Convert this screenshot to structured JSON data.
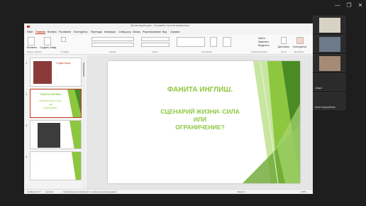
{
  "window": {
    "title": "Презентация1.pptx - Сохранено на этом компьютере",
    "controls": [
      "—",
      "❐",
      "✕"
    ]
  },
  "menu": {
    "items": [
      "Файл",
      "Главная",
      "Вставка",
      "Рисование",
      "Конструктор",
      "Переходы",
      "Анимация",
      "Слайд-шоу",
      "Запись",
      "Рецензирование",
      "Вид",
      "Справка"
    ],
    "active_index": 1
  },
  "ribbon": {
    "groups": [
      "Буфер обмена",
      "Слайды",
      "Шрифт",
      "Абзац",
      "Рисование",
      "Редактирование",
      "Голос",
      "Дизайнер"
    ],
    "buttons": {
      "paste": "Вставить",
      "new_slide": "Создать слайд",
      "reuse": "Повторное использование слайдов",
      "find": "Найти",
      "replace": "Заменить",
      "select": "Выделить",
      "dictate": "Диктовать",
      "designer": "Конструктор"
    }
  },
  "thumbnails": [
    {
      "num": "1",
      "title": "Стадии брака",
      "body": [
        "…",
        "…",
        "…"
      ]
    },
    {
      "num": "2",
      "title": "ФАНИТА ИНГЛИШ.",
      "body": [
        "СЦЕНАРИЙ ЖИЗНИ- СИЛА",
        "ИЛИ",
        "ОГРАНИЧЕНИЕ?"
      ]
    },
    {
      "num": "3",
      "title": "",
      "body": [
        "…",
        "…"
      ]
    },
    {
      "num": "4",
      "title": "",
      "body": [
        "…",
        "…",
        "…"
      ]
    }
  ],
  "slide": {
    "title": "ФАНИТА ИНГЛИШ.",
    "subtitle_line1": "СЦЕНАРИЙ ЖИЗНИ- СИЛА",
    "subtitle_line2": "ИЛИ",
    "subtitle_line3": "ОГРАНИЧЕНИЕ?"
  },
  "status": {
    "slide_of": "Слайд 2 из 17",
    "language": "русский",
    "accessibility": "Специальные возможности: проверьте рекомендации",
    "notes": "Заметки",
    "zoom": "106%"
  },
  "participants": [
    {
      "name": ""
    },
    {
      "name": ""
    },
    {
      "name": ""
    },
    {
      "name": "Jacqui"
    },
    {
      "name": "Анна Подгорбенко"
    }
  ],
  "colors": {
    "accent": "#c43e1c",
    "slide_green": "#8dc63f",
    "dark_green": "#4a8b25"
  }
}
